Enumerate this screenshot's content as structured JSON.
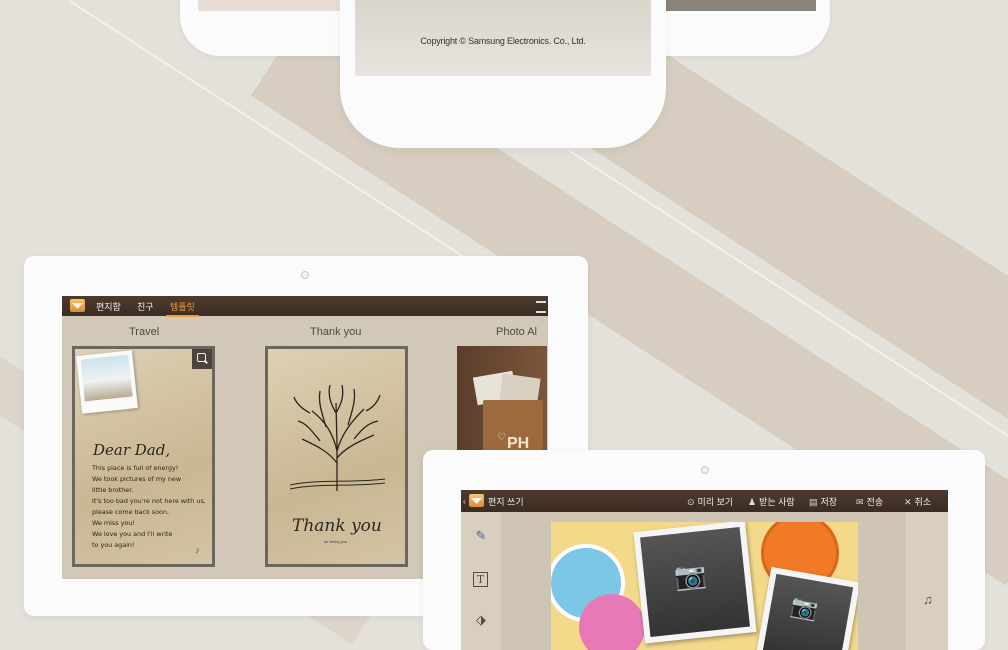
{
  "phone": {
    "copyright": "Copyright © Samsung Electronics. Co., Ltd."
  },
  "tablet_templates": {
    "tabs": [
      {
        "label": "편지함",
        "active": false
      },
      {
        "label": "친구",
        "active": false
      },
      {
        "label": "템플릿",
        "active": true
      }
    ],
    "columns": [
      {
        "title": "Travel"
      },
      {
        "title": "Thank you"
      },
      {
        "title": "Photo Al"
      }
    ],
    "travel_card": {
      "heading": "Dear Dad,",
      "lines": [
        "This place is full of energy!",
        "We took pictures of my new",
        "little brother.",
        "It's too bad you're not here with us,",
        "please come back soon.",
        "We miss you!",
        "We love you and I'll write",
        "to you again!"
      ]
    },
    "thankyou_card": {
      "heading": "Thank you",
      "sub": "for being you"
    },
    "album_card": {
      "text": "PH"
    }
  },
  "tablet_compose": {
    "title": "편지 쓰기",
    "actions": [
      {
        "icon": "preview-icon",
        "label": "미리 보기"
      },
      {
        "icon": "recipient-icon",
        "label": "받는 사람"
      },
      {
        "icon": "save-icon",
        "label": "저장"
      },
      {
        "icon": "send-icon",
        "label": "전송"
      },
      {
        "icon": "close-icon",
        "label": "취소"
      }
    ],
    "tools": [
      "brush-icon",
      "text-icon",
      "eraser-icon"
    ],
    "right_tool": "music-icon"
  },
  "colors": {
    "accent": "#f39a3c",
    "appbar": "#43332a",
    "background": "#e4e0da"
  }
}
